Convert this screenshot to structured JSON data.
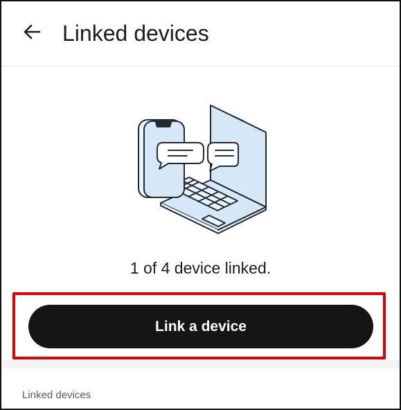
{
  "header": {
    "back_icon": "arrow-left-icon",
    "title": "Linked devices"
  },
  "illustration": {
    "icon": "phone-laptop-chat-illustration",
    "stroke_color": "#1f2a33",
    "fill_color": "#d6e8f7"
  },
  "status": {
    "linked_count_text": "1 of 4 device linked."
  },
  "primary_action": {
    "label": "Link a device",
    "background": "#151515",
    "highlight_color": "#e00000"
  },
  "section": {
    "label": "Linked devices"
  }
}
